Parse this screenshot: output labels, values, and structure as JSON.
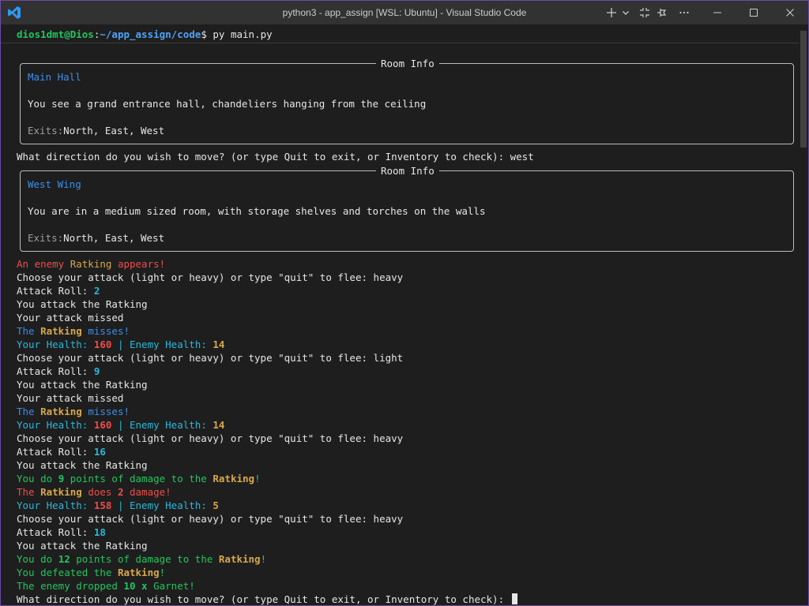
{
  "window": {
    "title": "python3 - app_assign [WSL: Ubuntu] - Visual Studio Code",
    "accent": "#6b4ba8"
  },
  "titlebar_icons": [
    "vscode-logo-icon",
    "plus-icon",
    "chevron-down-icon",
    "split-icon",
    "pin-icon",
    "more-icon",
    "minimize-icon",
    "maximize-icon",
    "close-icon"
  ],
  "prompt": {
    "user_host": "dios1dmt@Dios",
    "path": "~/app_assign/code",
    "symbol": "$",
    "command": " py main.py"
  },
  "panels": [
    {
      "title": "Room Info",
      "name": "Main Hall",
      "description": "You see a grand entrance hall, chandeliers hanging from the ceiling",
      "exits_label": "Exits:",
      "exits": "North, East, West"
    },
    {
      "title": "Room Info",
      "name": "West Wing",
      "description": "You are in a medium sized room, with storage shelves and torches on the walls",
      "exits_label": "Exits:",
      "exits": "North, East, West"
    }
  ],
  "lines": {
    "move1": "What direction do you wish to move? (or type Quit to exit, or Inventory to check): west",
    "enemy_pre": "An enemy ",
    "enemy_name": "Ratking",
    "enemy_post": " appears!",
    "choose_text": "Choose your attack (light or heavy) or type \"quit\" to flee: ",
    "attack_roll_label": "Attack Roll: ",
    "you_attack": "You attack the Ratking",
    "attack_missed": "Your attack missed",
    "the": "The ",
    "misses": " misses!",
    "your_health_label": "Your Health: ",
    "separator": " | ",
    "enemy_health_label": "Enemy Health: ",
    "you_do": "You do ",
    "points_of_damage": " points of damage to the ",
    "exclaim": "!",
    "does": " does ",
    "damage": " damage!",
    "you_defeated": "You defeated the ",
    "dropped_pre": "The enemy dropped ",
    "dropped_qty": "10 x",
    "dropped_item": " Garnet!",
    "move2": "What direction do you wish to move? (or type Quit to exit, or Inventory to check): "
  },
  "combat": {
    "choices": [
      "heavy",
      "light",
      "heavy",
      "heavy"
    ],
    "rolls": [
      "2",
      "9",
      "16",
      "18"
    ],
    "player_health": [
      "160",
      "160",
      "158"
    ],
    "enemy_health": [
      "14",
      "14",
      "5"
    ],
    "damage_dealt": [
      "9",
      "12"
    ],
    "damage_taken": "2"
  }
}
